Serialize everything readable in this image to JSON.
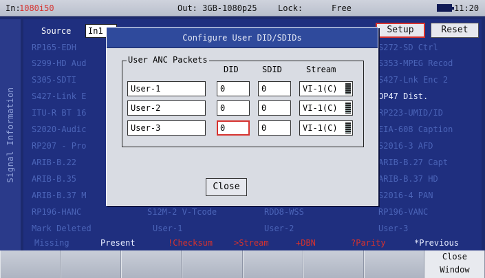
{
  "topbar": {
    "input_label": "In:",
    "input_value": "1080i50",
    "output": "Out: 3GB-1080p25",
    "lock_label": "Lock:",
    "lock_value": "Free",
    "clock": "11:20",
    "battery_icon": "battery-icon"
  },
  "side_tab": {
    "label": "Signal Information"
  },
  "source": {
    "label": "Source",
    "value": "In1"
  },
  "buttons": {
    "setup": "Setup",
    "reset": "Reset"
  },
  "grid": {
    "left_column": [
      "RP165-EDH",
      "S299-HD Aud",
      "S305-SDTI",
      "S427-Link E",
      "ITU-R BT 16",
      "S2020-Audic",
      "RP207 - Pro",
      "ARIB-B.22",
      "ARIB-B.35",
      "ARIB-B.37 M",
      "RP196-HANC",
      "Mark Deleted"
    ],
    "right_column": [
      "S272-SD Ctrl",
      "S353-MPEG Recod",
      "S427-Lnk Enc 2",
      "OP47 Dist.",
      "RP223-UMID/ID",
      "EIA-608 Caption",
      "S2016-3 AFD",
      "ARIB-B.27 Capt",
      "ARIB-B.37 HD",
      "S2016-4 PAN",
      "RP196-VANC",
      "User-3"
    ],
    "middle_row_1": [
      "S12M-2 V-Tcode",
      "RDD8-WSS"
    ],
    "middle_row_2": [
      "User-1",
      "User-2"
    ]
  },
  "legend": {
    "missing": "Missing",
    "present": "Present",
    "checksum": "!Checksum",
    "stream": ">Stream",
    "dbn": "+DBN",
    "parity": "?Parity",
    "previous": "*Previous"
  },
  "softkeys": [
    {
      "line1": "",
      "line2": ""
    },
    {
      "line1": "",
      "line2": ""
    },
    {
      "line1": "",
      "line2": ""
    },
    {
      "line1": "",
      "line2": ""
    },
    {
      "line1": "",
      "line2": ""
    },
    {
      "line1": "",
      "line2": ""
    },
    {
      "line1": "",
      "line2": ""
    },
    {
      "line1": "Close",
      "line2": "Window"
    }
  ],
  "dialog": {
    "title": "Configure User DID/SDIDs",
    "group_label": "User ANC Packets",
    "headers": {
      "did": "DID",
      "sdid": "SDID",
      "stream": "Stream"
    },
    "rows": [
      {
        "name": "User-1",
        "did": "0",
        "sdid": "0",
        "stream": "VI-1(C)"
      },
      {
        "name": "User-2",
        "did": "0",
        "sdid": "0",
        "stream": "VI-1(C)"
      },
      {
        "name": "User-3",
        "did": "0",
        "sdid": "0",
        "stream": "VI-1(C)"
      }
    ],
    "close": "Close"
  },
  "colors": {
    "background": "#1f2f7f",
    "accent_red": "#d6322e",
    "dim_text": "#4b64b8",
    "dialog_title": "#2f4a9c"
  }
}
